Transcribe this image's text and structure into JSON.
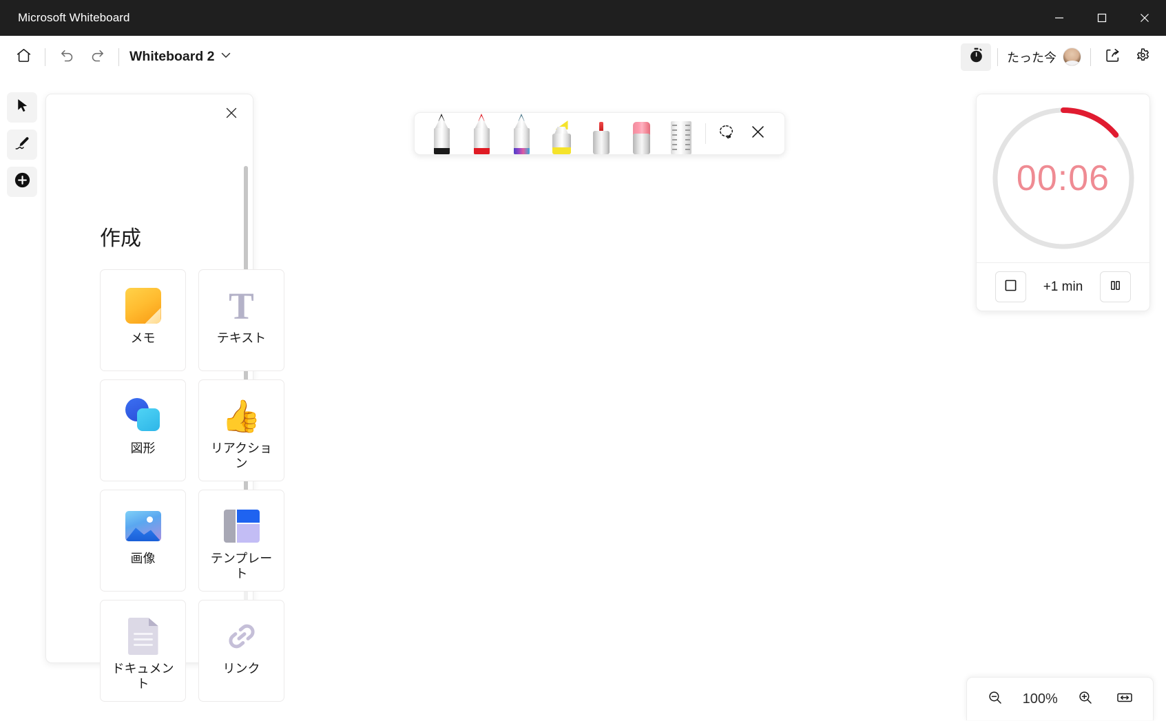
{
  "window": {
    "title": "Microsoft Whiteboard",
    "minimize_label": "minimize",
    "maximize_label": "maximize",
    "close_label": "close"
  },
  "commandbar": {
    "home_label": "home",
    "undo_label": "undo",
    "redo_label": "redo",
    "document_title": "Whiteboard 2",
    "title_dropdown_label": "chevron-down",
    "timer_toggle_label": "timer",
    "presence_text": "たった今",
    "avatar_label": "user avatar",
    "share_label": "share",
    "settings_label": "settings"
  },
  "rail": {
    "items": [
      {
        "id": "select",
        "label": "select",
        "active": false
      },
      {
        "id": "ink",
        "label": "ink",
        "active": false
      },
      {
        "id": "create",
        "label": "create",
        "active": true
      }
    ]
  },
  "create_panel": {
    "title": "作成",
    "close_label": "close",
    "cards": [
      {
        "id": "note",
        "label": "メモ"
      },
      {
        "id": "text",
        "label": "テキスト"
      },
      {
        "id": "shape",
        "label": "図形"
      },
      {
        "id": "reaction",
        "label": "リアクション"
      },
      {
        "id": "image",
        "label": "画像"
      },
      {
        "id": "template",
        "label": "テンプレート"
      },
      {
        "id": "document",
        "label": "ドキュメント"
      },
      {
        "id": "link",
        "label": "リンク"
      }
    ]
  },
  "pen_toolbar": {
    "tools": [
      {
        "id": "pen-black",
        "label": "black pen",
        "color": "#1b1b1b"
      },
      {
        "id": "pen-red",
        "label": "red pen",
        "color": "#e01b24"
      },
      {
        "id": "pen-rainbow",
        "label": "rainbow pen",
        "color": "#4e7a8c"
      },
      {
        "id": "highlighter-yellow",
        "label": "yellow highlighter",
        "color": "#f5e32b"
      },
      {
        "id": "laser-pointer",
        "label": "laser pointer",
        "color": "#e03030"
      },
      {
        "id": "eraser",
        "label": "eraser",
        "color": "#ff9aad"
      },
      {
        "id": "ruler",
        "label": "ruler",
        "color": "#cfcfcf"
      }
    ],
    "lasso_label": "lasso select",
    "close_label": "close"
  },
  "timer": {
    "display": "00:06",
    "progress_percent": 14,
    "accent_color": "#e01b30",
    "digit_color": "#ef8b93",
    "track_color": "#e3e3e3",
    "stop_label": "stop",
    "add_minute_label": "+1 min",
    "pause_label": "pause"
  },
  "zoom_controls": {
    "zoom_out_label": "zoom out",
    "level": "100%",
    "zoom_in_label": "zoom in",
    "fit_label": "fit to screen"
  }
}
